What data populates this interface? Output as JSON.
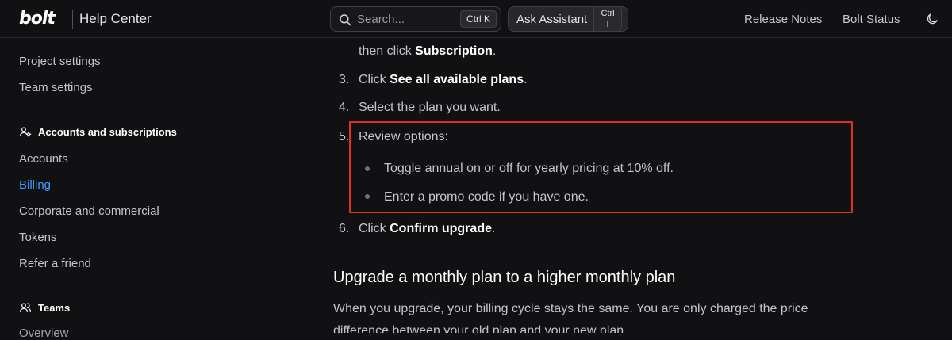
{
  "header": {
    "logo": "bolt",
    "title": "Help Center",
    "search": {
      "placeholder": "Search...",
      "shortcut": "Ctrl K"
    },
    "assistant": {
      "label": "Ask Assistant",
      "shortcut_line1": "Ctrl",
      "shortcut_line2": "I"
    },
    "links": [
      "Release Notes",
      "Bolt Status"
    ],
    "theme_icon": "moon-icon"
  },
  "sidebar": {
    "items_top": [
      {
        "label": "Project settings"
      },
      {
        "label": "Team settings"
      }
    ],
    "section_accounts": {
      "label": "Accounts and subscriptions",
      "icon": "users-gear-icon"
    },
    "items_accounts": [
      {
        "label": "Accounts",
        "active": false
      },
      {
        "label": "Billing",
        "active": true
      },
      {
        "label": "Corporate and commercial",
        "active": false
      },
      {
        "label": "Tokens",
        "active": false
      },
      {
        "label": "Refer a friend",
        "active": false
      }
    ],
    "section_teams": {
      "label": "Teams",
      "icon": "users-icon"
    },
    "cut_item": "Overview"
  },
  "content": {
    "step_cont": {
      "prefix": "then click ",
      "bold": "Subscription",
      "suffix": "."
    },
    "step3": {
      "num": "3.",
      "prefix": "Click ",
      "bold": "See all available plans",
      "suffix": "."
    },
    "step4": {
      "num": "4.",
      "text": "Select the plan you want."
    },
    "step5": {
      "num": "5.",
      "text": "Review options:"
    },
    "bullets": [
      "Toggle annual on or off for yearly pricing at 10% off.",
      "Enter a promo code if you have one."
    ],
    "step6": {
      "num": "6.",
      "prefix": "Click ",
      "bold": "Confirm upgrade",
      "suffix": "."
    },
    "heading": "Upgrade a monthly plan to a higher monthly plan",
    "para_line1": "When you upgrade, your billing cycle stays the same. You are only charged the price",
    "para_line2": "difference between your old plan and your new plan."
  },
  "colors": {
    "background": "#111113",
    "accent": "#3b9bff",
    "highlight_border": "#e0302a"
  }
}
